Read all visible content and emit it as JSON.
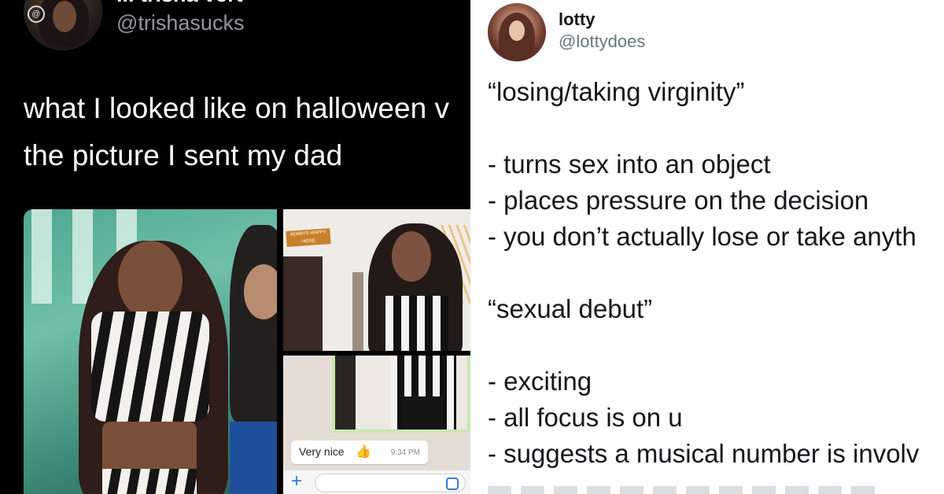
{
  "left_tweet": {
    "display_name": "lil trisha vert",
    "handle": "@trishasucks",
    "text_lines": [
      "what I looked like on halloween v",
      "the picture I sent my dad"
    ],
    "photos": {
      "room_sign_text": "ALWAYS HAPPY HERE",
      "chat": {
        "message": "Very nice",
        "time": "9:34 PM",
        "plus_label": "+"
      }
    }
  },
  "right_tweet": {
    "display_name": "lotty",
    "handle": "@lottydoes",
    "text": "“losing/taking virginity”\n\n- turns sex into an object\n- places pressure on the decision\n- you don’t actually lose or take anyth\n\n“sexual debut”\n\n- exciting\n- all focus is on u\n- suggests a musical number is involv"
  }
}
